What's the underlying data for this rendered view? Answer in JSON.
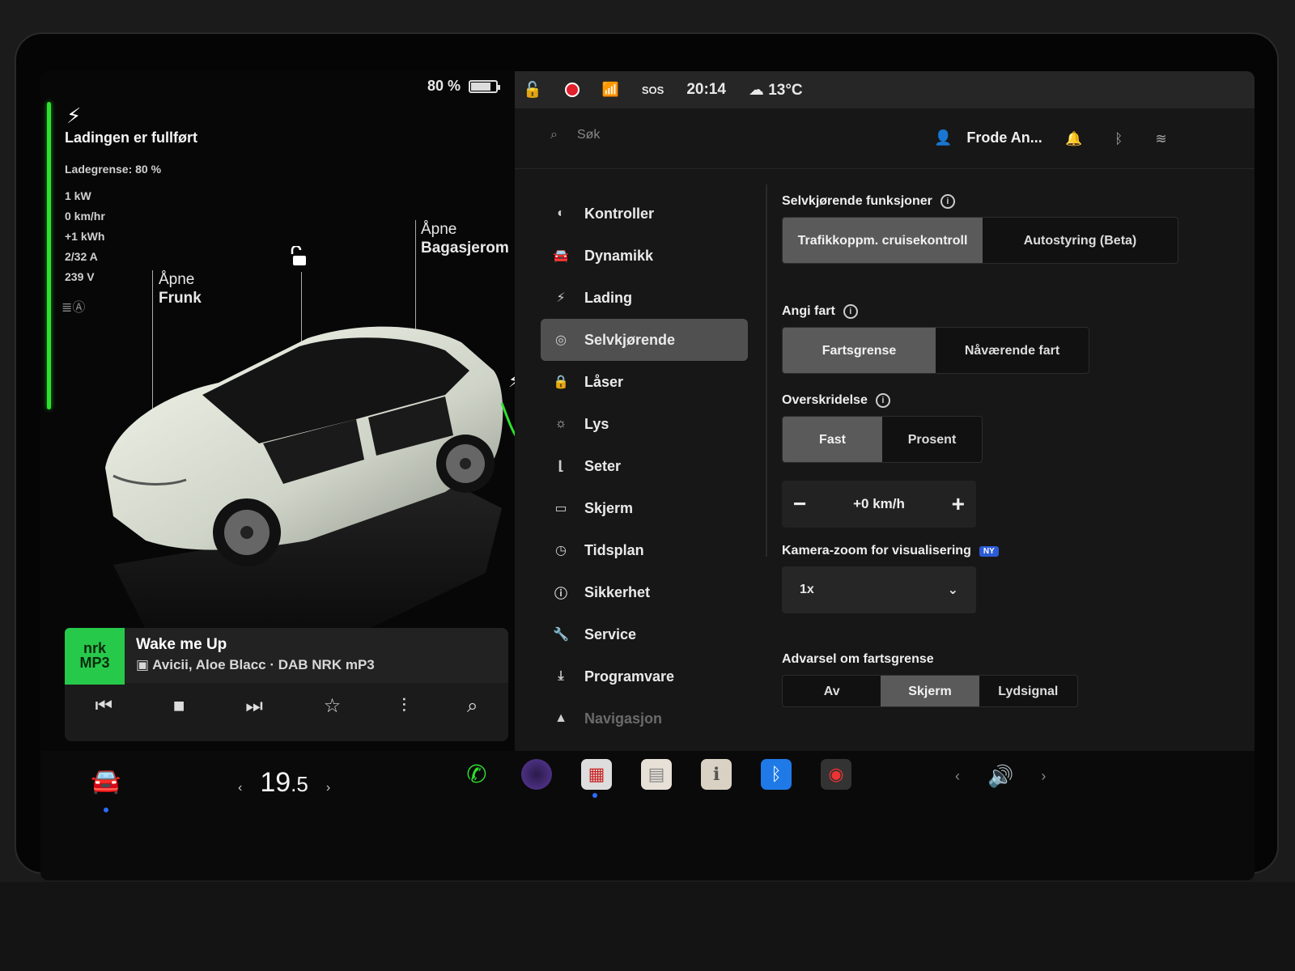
{
  "status": {
    "battery_percent_label": "80 %",
    "battery_level": 0.8,
    "time": "20:14",
    "sos": "SOS",
    "weather": "13°C"
  },
  "charging": {
    "title": "Ladingen er fullført",
    "limit": "Ladegrense: 80 %",
    "stats": [
      "1 kW",
      "0 km/hr",
      "+1 kWh",
      "2/32 A",
      "239 V"
    ]
  },
  "car": {
    "frunk_line1": "Åpne",
    "frunk_line2": "Frunk",
    "trunk_line1": "Åpne",
    "trunk_line2": "Bagasjerom"
  },
  "media": {
    "logo_line1": "nrk",
    "logo_line2": "MP3",
    "title": "Wake me Up",
    "artist": "Avicii, Aloe Blacc · DAB NRK mP3"
  },
  "header": {
    "search_placeholder": "Søk",
    "user_name": "Frode An..."
  },
  "menu": [
    {
      "label": "Kontroller",
      "icon": "toggle-icon"
    },
    {
      "label": "Dynamikk",
      "icon": "car-icon"
    },
    {
      "label": "Lading",
      "icon": "bolt-icon"
    },
    {
      "label": "Selvkjørende",
      "icon": "steering-wheel-icon",
      "active": true
    },
    {
      "label": "Låser",
      "icon": "lock-icon"
    },
    {
      "label": "Lys",
      "icon": "sun-icon"
    },
    {
      "label": "Seter",
      "icon": "seat-icon"
    },
    {
      "label": "Skjerm",
      "icon": "display-icon"
    },
    {
      "label": "Tidsplan",
      "icon": "schedule-icon"
    },
    {
      "label": "Sikkerhet",
      "icon": "alert-icon"
    },
    {
      "label": "Service",
      "icon": "wrench-icon"
    },
    {
      "label": "Programvare",
      "icon": "download-icon"
    },
    {
      "label": "Navigasjon",
      "icon": "navigation-icon"
    }
  ],
  "settings": {
    "autopilot_title": "Selvkjørende funksjoner",
    "autopilot_opt1": "Trafikkoppm. cruisekontroll",
    "autopilot_opt2": "Autostyring (Beta)",
    "speed_title": "Angi fart",
    "speed_opt1": "Fartsgrense",
    "speed_opt2": "Nåværende fart",
    "offset_title": "Overskridelse",
    "offset_opt1": "Fast",
    "offset_opt2": "Prosent",
    "offset_value": "+0 km/h",
    "zoom_title": "Kamera-zoom for visualisering",
    "zoom_badge": "NY",
    "zoom_value": "1x",
    "warning_title": "Advarsel om fartsgrense",
    "warning_opt1": "Av",
    "warning_opt2": "Skjerm",
    "warning_opt3": "Lydsignal"
  },
  "dock": {
    "temperature_whole": "19",
    "temperature_decimal": ".5"
  },
  "colors": {
    "charge_green": "#2ee02e",
    "record_red": "#e0202c",
    "accent_blue": "#2e6bff"
  }
}
